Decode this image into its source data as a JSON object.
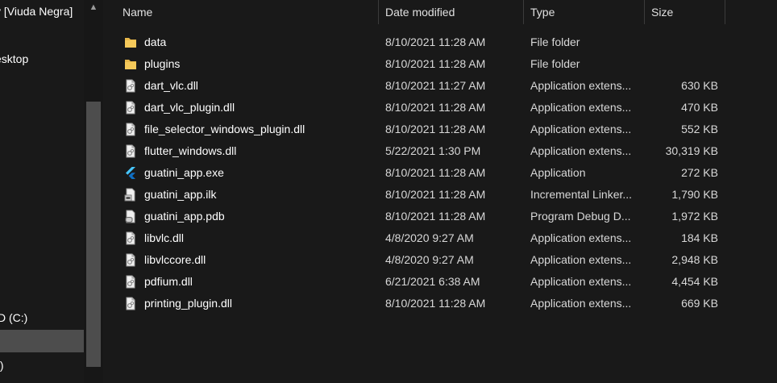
{
  "nav": {
    "items": [
      {
        "label": "v [Viuda Negra]"
      },
      {
        "label": "esktop"
      },
      {
        "label": "D (C:)"
      },
      {
        "label": ""
      },
      {
        "label": ":)"
      }
    ]
  },
  "columns": {
    "name": "Name",
    "date": "Date modified",
    "type": "Type",
    "size": "Size"
  },
  "files": [
    {
      "name": "data",
      "date": "8/10/2021 11:28 AM",
      "type": "File folder",
      "size": "",
      "icon": "folder-icon"
    },
    {
      "name": "plugins",
      "date": "8/10/2021 11:28 AM",
      "type": "File folder",
      "size": "",
      "icon": "folder-icon"
    },
    {
      "name": "dart_vlc.dll",
      "date": "8/10/2021 11:27 AM",
      "type": "Application extens...",
      "size": "630 KB",
      "icon": "dll-file-icon"
    },
    {
      "name": "dart_vlc_plugin.dll",
      "date": "8/10/2021 11:28 AM",
      "type": "Application extens...",
      "size": "470 KB",
      "icon": "dll-file-icon"
    },
    {
      "name": "file_selector_windows_plugin.dll",
      "date": "8/10/2021 11:28 AM",
      "type": "Application extens...",
      "size": "552 KB",
      "icon": "dll-file-icon"
    },
    {
      "name": "flutter_windows.dll",
      "date": "5/22/2021 1:30 PM",
      "type": "Application extens...",
      "size": "30,319 KB",
      "icon": "dll-file-icon"
    },
    {
      "name": "guatini_app.exe",
      "date": "8/10/2021 11:28 AM",
      "type": "Application",
      "size": "272 KB",
      "icon": "flutter-icon"
    },
    {
      "name": "guatini_app.ilk",
      "date": "8/10/2021 11:28 AM",
      "type": "Incremental Linker...",
      "size": "1,790 KB",
      "icon": "ilk-file-icon"
    },
    {
      "name": "guatini_app.pdb",
      "date": "8/10/2021 11:28 AM",
      "type": "Program Debug D...",
      "size": "1,972 KB",
      "icon": "pdb-file-icon"
    },
    {
      "name": "libvlc.dll",
      "date": "4/8/2020 9:27 AM",
      "type": "Application extens...",
      "size": "184 KB",
      "icon": "dll-file-icon"
    },
    {
      "name": "libvlccore.dll",
      "date": "4/8/2020 9:27 AM",
      "type": "Application extens...",
      "size": "2,948 KB",
      "icon": "dll-file-icon"
    },
    {
      "name": "pdfium.dll",
      "date": "6/21/2021 6:38 AM",
      "type": "Application extens...",
      "size": "4,454 KB",
      "icon": "dll-file-icon"
    },
    {
      "name": "printing_plugin.dll",
      "date": "8/10/2021 11:28 AM",
      "type": "Application extens...",
      "size": "669 KB",
      "icon": "dll-file-icon"
    }
  ],
  "colors": {
    "background": "#191919",
    "folder": "#e8b84a",
    "selected": "#4d4d4d",
    "flutter": "#47c5fb"
  }
}
